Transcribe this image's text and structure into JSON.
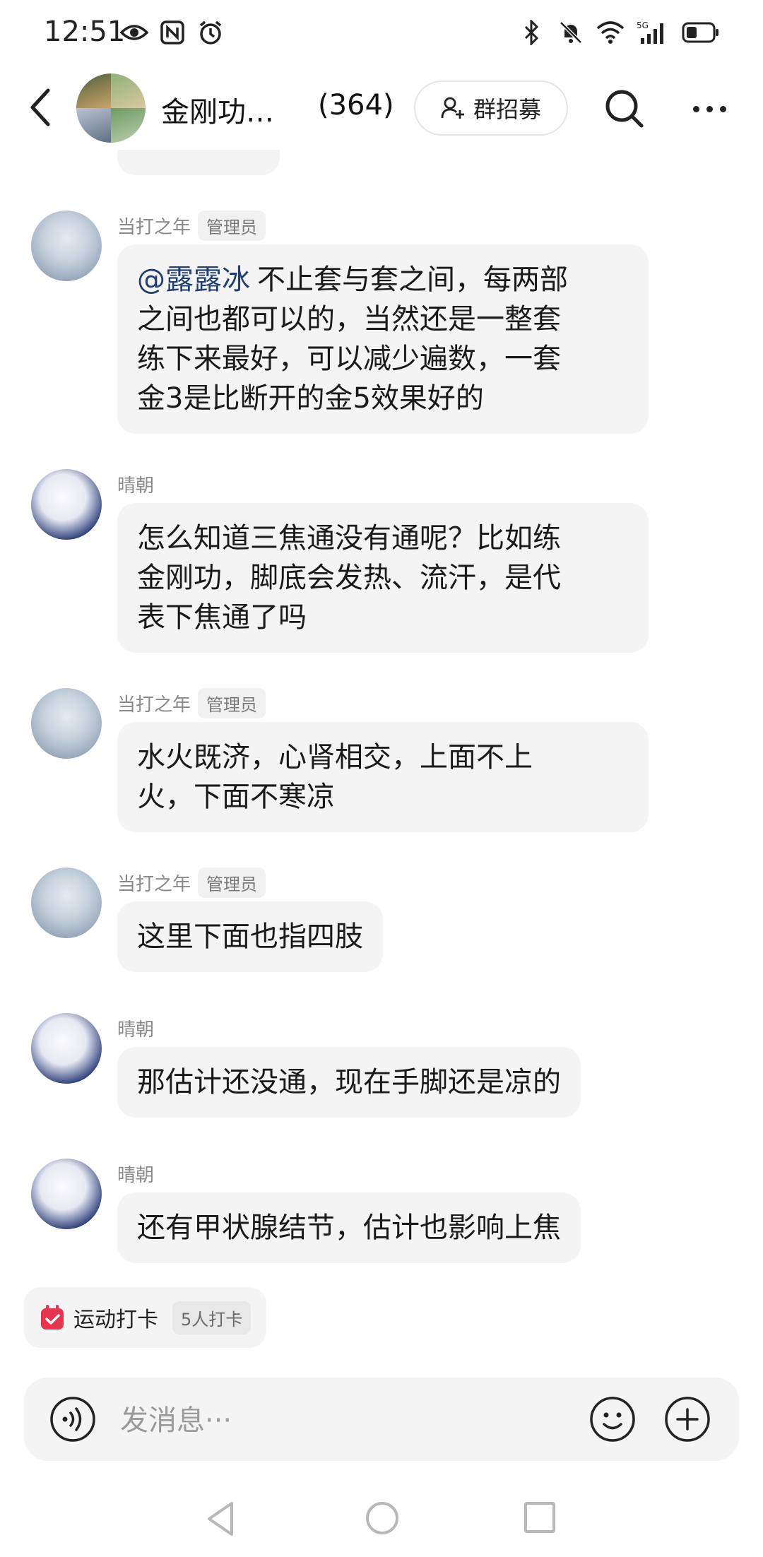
{
  "status_bar": {
    "time": "12:51",
    "network": "5G"
  },
  "header": {
    "title": "金刚功…",
    "member_count": "(364)",
    "recruit_label": "群招募"
  },
  "messages": [
    {
      "sender": "当打之年",
      "badge": "管理员",
      "mention": "@露露冰",
      "lines": [
        "不止套与套之间，每两部",
        "之间也都可以的，当然还是一整套",
        "练下来最好，可以减少遍数，一套",
        "金3是比断开的金5效果好的"
      ]
    },
    {
      "sender": "晴朝",
      "badge": "",
      "lines": [
        "怎么知道三焦通没有通呢？比如练",
        "金刚功，脚底会发热、流汗，是代",
        "表下焦通了吗"
      ]
    },
    {
      "sender": "当打之年",
      "badge": "管理员",
      "lines": [
        "水火既济，心肾相交，上面不上",
        "火，下面不寒凉"
      ]
    },
    {
      "sender": "当打之年",
      "badge": "管理员",
      "lines": [
        "这里下面也指四肢"
      ]
    },
    {
      "sender": "晴朝",
      "badge": "",
      "lines": [
        "那估计还没通，现在手脚还是凉的"
      ]
    },
    {
      "sender": "晴朝",
      "badge": "",
      "lines": [
        "还有甲状腺结节，估计也影响上焦"
      ]
    }
  ],
  "checkin": {
    "label": "运动打卡",
    "count": "5人打卡"
  },
  "input": {
    "placeholder": "发消息···"
  },
  "colors": {
    "mention": "#1f3f73",
    "bubble": "#f4f4f5",
    "checkin_icon": "#e8344e"
  }
}
